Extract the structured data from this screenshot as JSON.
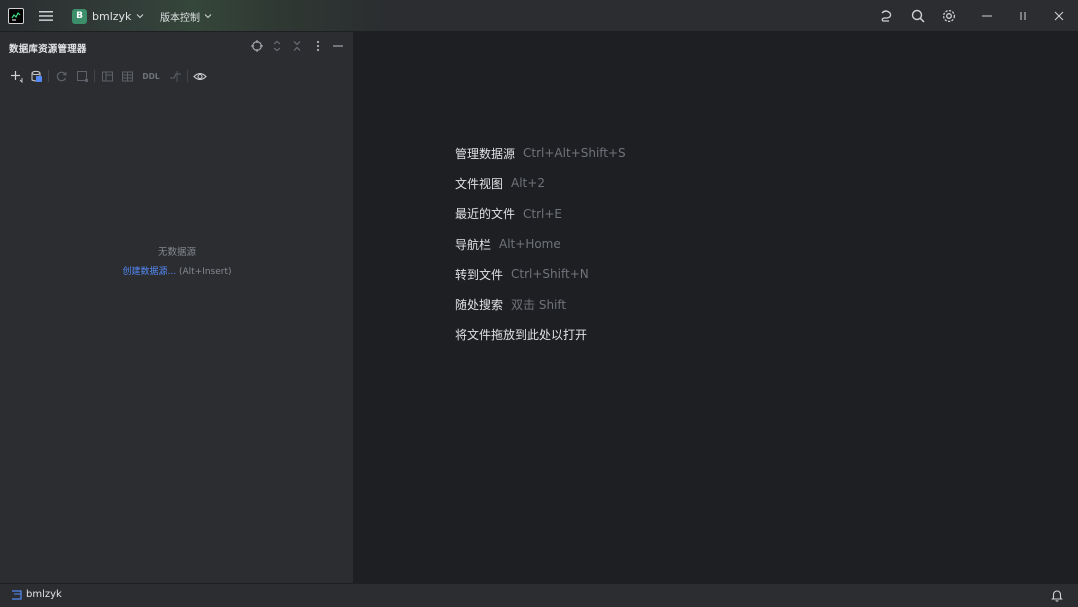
{
  "titlebar": {
    "app_icon": "datagrip-logo-icon",
    "project": {
      "badge": "B",
      "name": "bmlzyk",
      "badge_color": "#3c8f6a"
    },
    "vcs_label": "版本控制",
    "icons": [
      "ai-assistant-icon",
      "search-icon",
      "gear-icon"
    ],
    "window_controls": [
      "minimize-icon",
      "maximize-icon",
      "close-icon"
    ]
  },
  "left_panel": {
    "title": "数据库资源管理器",
    "header_icons": [
      "target-icon",
      "expand-all-icon",
      "collapse-all-icon",
      "more-vert-icon",
      "hide-icon"
    ],
    "toolbar": [
      "add-icon",
      "data-source-properties-icon",
      "refresh-icon",
      "query-console-icon",
      "edit-table-icon",
      "table-icon",
      "ddl-icon",
      "compare-icon",
      "view-options-icon"
    ],
    "ddl_label": "DDL",
    "empty": {
      "title": "无数据源",
      "create_link": "创建数据源...",
      "create_shortcut": "(Alt+Insert)"
    }
  },
  "editor": {
    "hints": [
      {
        "action": "管理数据源",
        "key": "Ctrl+Alt+Shift+S"
      },
      {
        "action": "文件视图",
        "key": "Alt+2"
      },
      {
        "action": "最近的文件",
        "key": "Ctrl+E"
      },
      {
        "action": "导航栏",
        "key": "Alt+Home"
      },
      {
        "action": "转到文件",
        "key": "Ctrl+Shift+N"
      },
      {
        "action": "随处搜索",
        "key": "双击 Shift"
      },
      {
        "action": "将文件拖放到此处以打开",
        "key": ""
      }
    ]
  },
  "statusbar": {
    "project_label": "bmlzyk",
    "icons": [
      "project-folder-icon",
      "notifications-bell-icon"
    ]
  },
  "colors": {
    "accent": "#548af7",
    "background": "#1e1f22",
    "panel": "#2b2d30",
    "muted_text": "#6f737a"
  }
}
